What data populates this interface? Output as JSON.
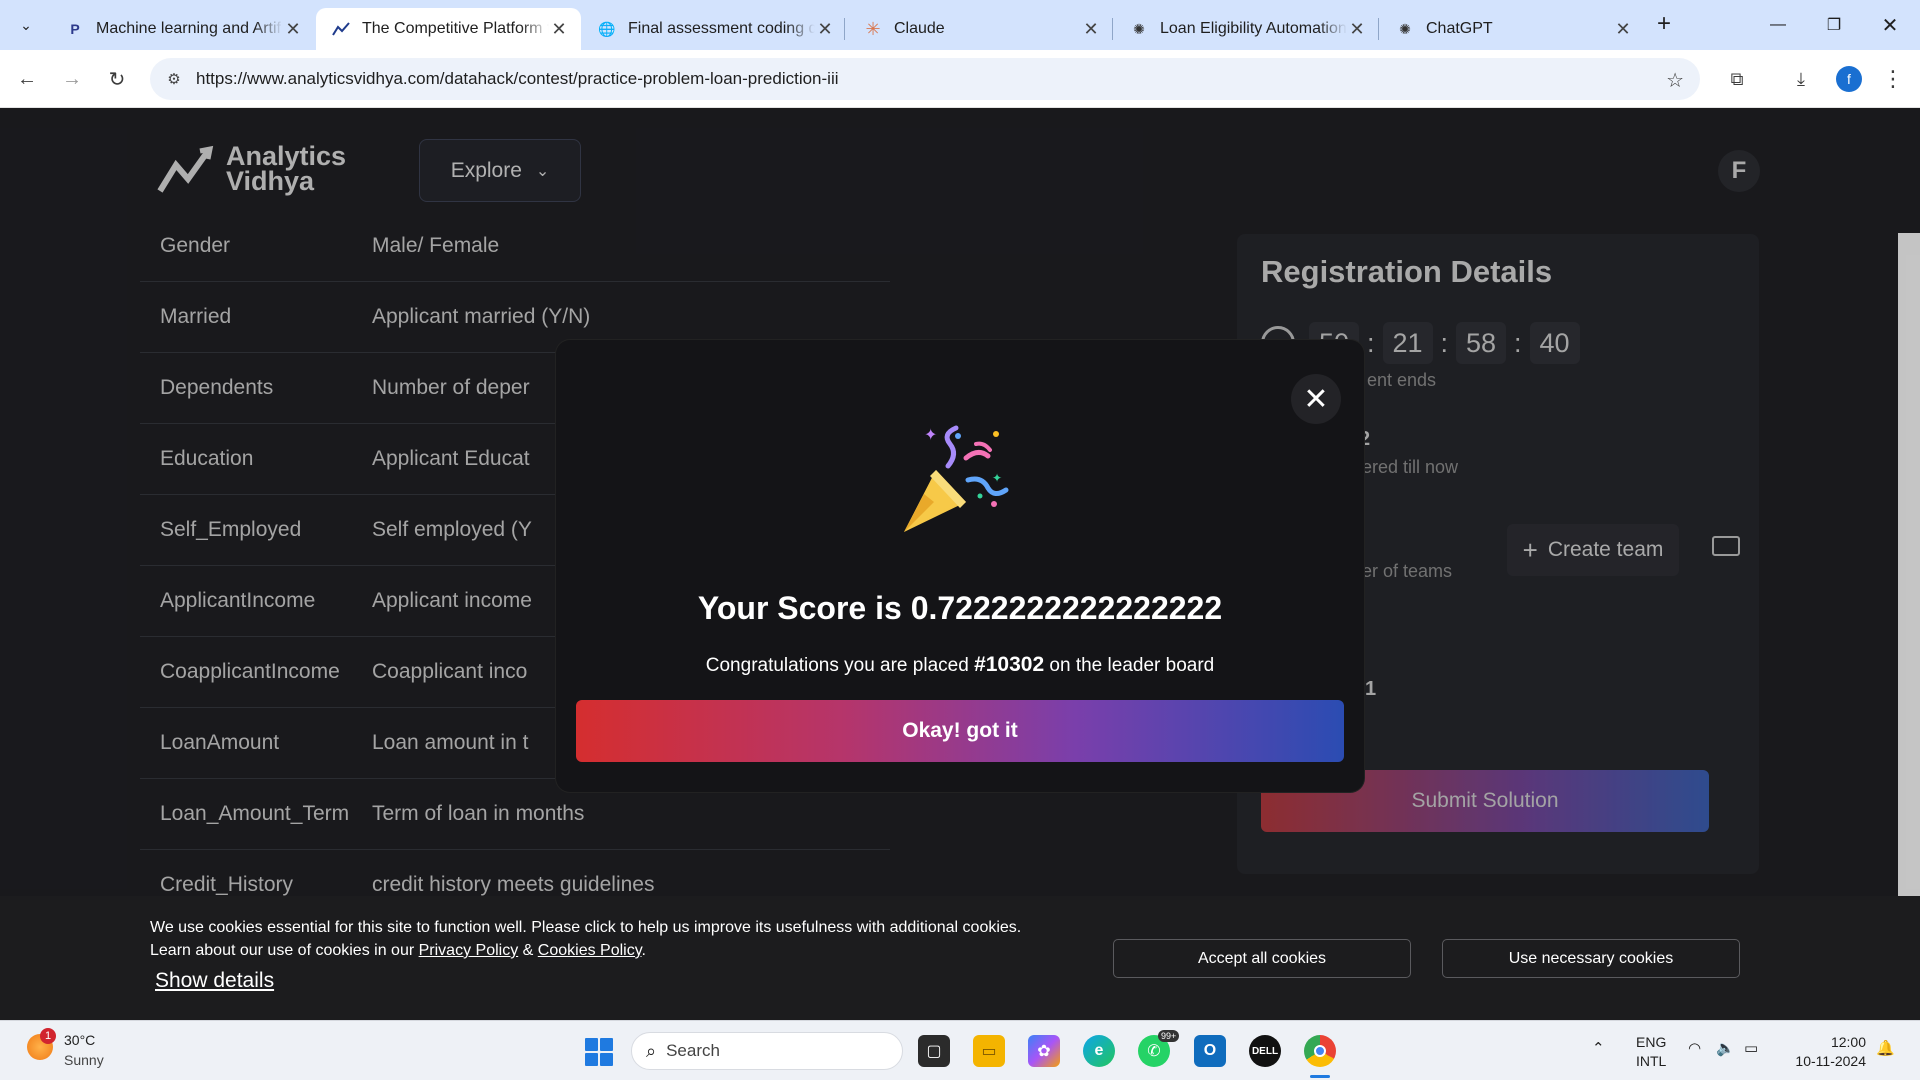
{
  "browser": {
    "tabs": [
      {
        "favicon": "P",
        "title": "Machine learning and Artif",
        "active": false
      },
      {
        "favicon": "av-logo",
        "title": "The Competitive Platform f",
        "active": true
      },
      {
        "favicon": "globe",
        "title": "Final assessment coding qu",
        "active": false
      },
      {
        "favicon": "claude-star",
        "title": "Claude",
        "active": false
      },
      {
        "favicon": "openai",
        "title": "Loan Eligibility Automation",
        "active": false
      },
      {
        "favicon": "openai",
        "title": "ChatGPT",
        "active": false
      }
    ],
    "url": "https://www.analyticsvidhya.com/datahack/contest/practice-problem-loan-prediction-iii",
    "profile_initial": "f"
  },
  "header": {
    "logo_line1": "Analytics",
    "logo_line2": "Vidhya",
    "explore_label": "Explore",
    "avatar_initial": "F"
  },
  "variables": [
    {
      "name": "Gender",
      "description": "Male/ Female"
    },
    {
      "name": "Married",
      "description": "Applicant married (Y/N)"
    },
    {
      "name": "Dependents",
      "description": "Number of deper"
    },
    {
      "name": "Education",
      "description": "Applicant Educat"
    },
    {
      "name": "Self_Employed",
      "description": "Self employed (Y"
    },
    {
      "name": "ApplicantIncome",
      "description": "Applicant income"
    },
    {
      "name": "CoapplicantIncome",
      "description": "Coapplicant inco"
    },
    {
      "name": "LoanAmount",
      "description": "Loan amount in t"
    },
    {
      "name": "Loan_Amount_Term",
      "description": "Term of loan in months"
    },
    {
      "name": "Credit_History",
      "description": "credit history meets guidelines"
    }
  ],
  "registration": {
    "title": "Registration Details",
    "timer": [
      "50",
      "21",
      "58",
      "40"
    ],
    "timer_label": "ent ends",
    "registered_count": "2",
    "registered_label": "ered till now",
    "teams_label": "er of teams",
    "create_team_label": "Create team",
    "rank_partial": "1",
    "submit_label": "Submit Solution"
  },
  "modal": {
    "score_text": "Your Score is 0.7222222222222222",
    "congrats_prefix": "Congratulations you are placed",
    "rank": "#10302",
    "congrats_suffix": "on the leader board",
    "okay_label": "Okay! got it"
  },
  "cookies": {
    "line1": "We use cookies essential for this site to function well. Please click to help us improve its usefulness with additional cookies.",
    "line2_prefix": "Learn about our use of cookies in our",
    "privacy_link": "Privacy Policy",
    "amp": "&",
    "cookies_link": "Cookies Policy",
    "line2_suffix": ".",
    "show_details": "Show details",
    "accept_all": "Accept all cookies",
    "necessary_only": "Use necessary cookies"
  },
  "taskbar": {
    "weather_badge": "1",
    "temperature": "30°C",
    "condition": "Sunny",
    "search_placeholder": "Search",
    "whatsapp_badge": "99+",
    "lang_top": "ENG",
    "lang_bottom": "INTL",
    "time": "12:00",
    "date": "10-11-2024"
  }
}
